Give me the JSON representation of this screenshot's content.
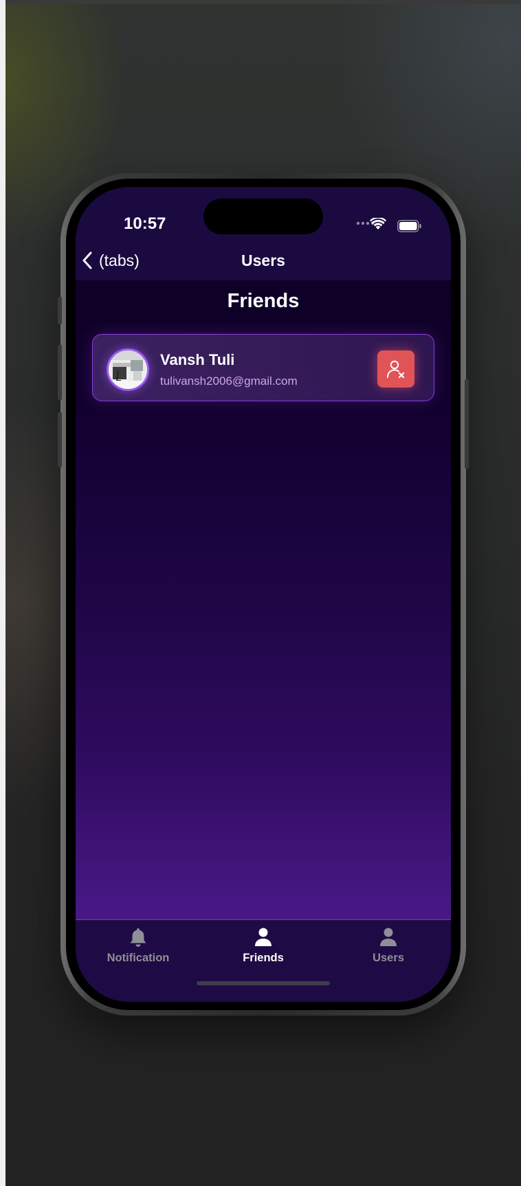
{
  "status_bar": {
    "time": "10:57"
  },
  "nav": {
    "back_label": "(tabs)",
    "title": "Users"
  },
  "page": {
    "heading": "Friends"
  },
  "friends": [
    {
      "name": "Vansh Tuli",
      "email": "tulivansh2006@gmail.com",
      "action_icon": "remove-friend-icon"
    }
  ],
  "tabbar": {
    "tabs": [
      {
        "label": "Notification",
        "icon": "bell-icon",
        "active": false
      },
      {
        "label": "Friends",
        "icon": "person-icon",
        "active": true
      },
      {
        "label": "Users",
        "icon": "person-icon",
        "active": false
      }
    ]
  },
  "colors": {
    "accent": "#8a3ee0",
    "remove_button": "#e05458",
    "header_bg": "#1b0a40",
    "tabbar_bg": "#1e0a44",
    "email_text": "#c9a6e4"
  }
}
